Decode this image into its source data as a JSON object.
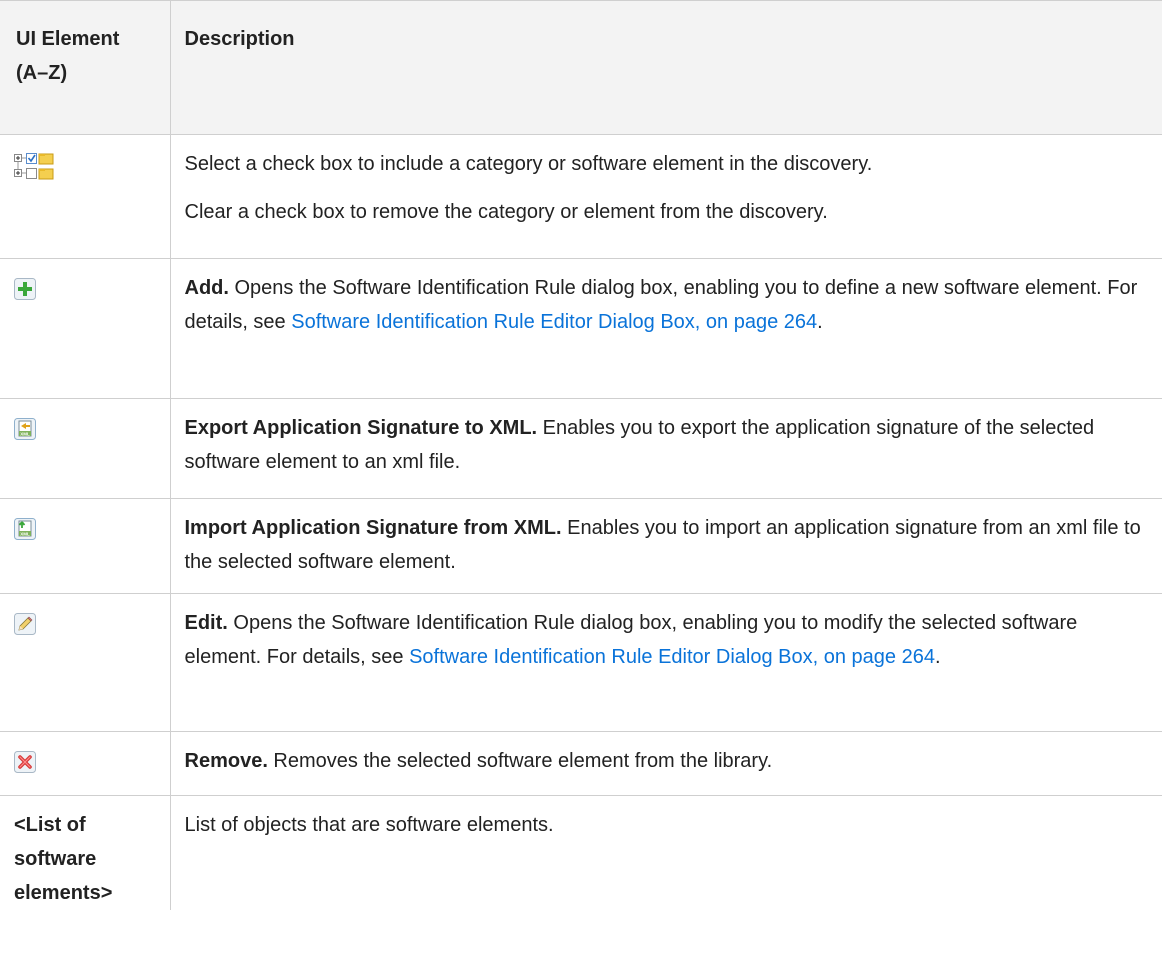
{
  "header": {
    "col1_line1": "UI Element",
    "col1_line2": "(A–Z)",
    "col2": "Description"
  },
  "rows": [
    {
      "icon": "tree-checkbox-folder-icons",
      "desc_p1": "Select a check box to include a category or software element in the discovery.",
      "desc_p2": "Clear a check box to remove the category or element from the discovery."
    },
    {
      "icon": "add-icon",
      "term": "Add.",
      "text": " Opens the Software Identification Rule dialog box, enabling you to define a new software element. For details, see ",
      "link": "Software Identification Rule Editor Dialog Box, on page 264",
      "after": "."
    },
    {
      "icon": "export-xml-icon",
      "term": "Export Application Signature to XML.",
      "text": " Enables you to export the application signature of the selected software element to an xml file."
    },
    {
      "icon": "import-xml-icon",
      "term": "Import Application Signature from XML.",
      "text": " Enables you to import an application signature from an xml file to the selected software element."
    },
    {
      "icon": "edit-pencil-icon",
      "term": "Edit.",
      "text": " Opens the Software Identification Rule dialog box, enabling you to modify the selected software element. For details, see ",
      "link": "Software Identification Rule Editor Dialog Box, on page 264",
      "after": "."
    },
    {
      "icon": "remove-icon",
      "term": "Remove.",
      "text": " Removes the selected software element from the library."
    },
    {
      "name": "<List of software elements>",
      "text": "List of objects that are software elements."
    }
  ],
  "colors": {
    "link": "#0a73d9",
    "header_bg": "#f3f3f3",
    "border": "#cfcfcf"
  }
}
